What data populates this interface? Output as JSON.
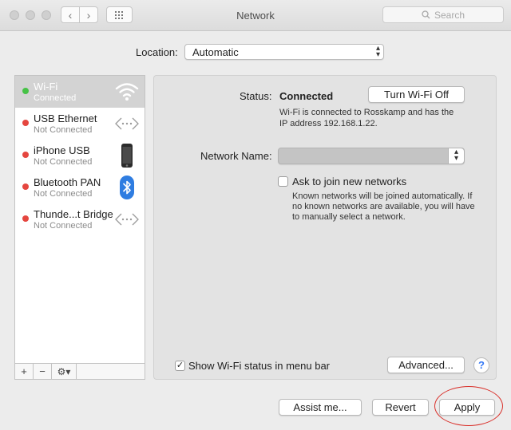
{
  "window": {
    "title": "Network"
  },
  "toolbar": {
    "back": "‹",
    "forward": "›",
    "search_placeholder": "Search"
  },
  "location": {
    "label": "Location:",
    "value": "Automatic"
  },
  "services": [
    {
      "name": "Wi-Fi",
      "status": "Connected",
      "dot": "#46c246",
      "icon": "wifi-icon",
      "selected": true
    },
    {
      "name": "USB Ethernet",
      "status": "Not Connected",
      "dot": "#e5463f",
      "icon": "ethernet-arrows-icon"
    },
    {
      "name": "iPhone USB",
      "status": "Not Connected",
      "dot": "#e5463f",
      "icon": "iphone-icon"
    },
    {
      "name": "Bluetooth PAN",
      "status": "Not Connected",
      "dot": "#e5463f",
      "icon": "bluetooth-icon"
    },
    {
      "name": "Thunde...t Bridge",
      "status": "Not Connected",
      "dot": "#e5463f",
      "icon": "ethernet-arrows-icon"
    }
  ],
  "sidebar_tools": {
    "add": "+",
    "remove": "−",
    "gear": "⚙▾"
  },
  "detail": {
    "status_label": "Status:",
    "status_value": "Connected",
    "turn_off_button": "Turn Wi-Fi Off",
    "status_desc_1": "Wi-Fi is connected to Rosskamp and has the",
    "status_desc_2": "IP address 192.168.1.22.",
    "network_name_label": "Network Name:",
    "network_name_value": "",
    "ask_join_label": "Ask to join new networks",
    "ask_join_checked": false,
    "ask_desc_1": "Known networks will be joined automatically. If",
    "ask_desc_2": "no known networks are available, you will have",
    "ask_desc_3": "to manually select a network.",
    "show_status_label": "Show Wi-Fi status in menu bar",
    "show_status_checked": true,
    "advanced_button": "Advanced...",
    "help": "?"
  },
  "footer": {
    "assist": "Assist me...",
    "revert": "Revert",
    "apply": "Apply"
  },
  "colors": {
    "annotation_circle": "#d9302a",
    "accent": "#3478f6"
  }
}
